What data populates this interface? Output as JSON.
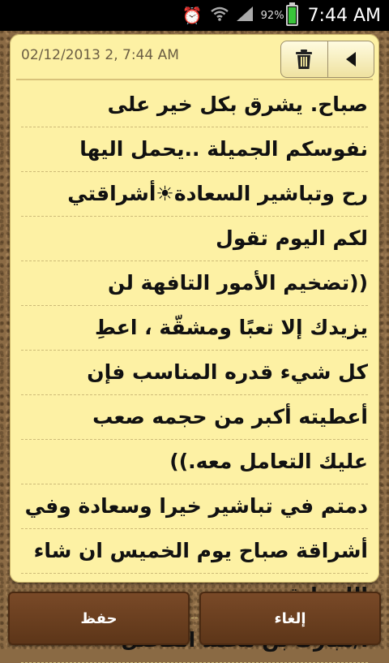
{
  "status_bar": {
    "battery_percent": "92%",
    "time": "7:44 AM",
    "icons": [
      "alarm-icon",
      "wifi-icon",
      "signal-icon",
      "battery-icon"
    ],
    "battery_color": "#39c43a"
  },
  "note": {
    "datetime": "02/12/2013 2, 7:44 AM",
    "delete_icon": "trash-icon",
    "back_icon": "back-arrow-icon",
    "paper_color": "#fdf1a4",
    "lines": [
      "صباح. يشرق بكل خير على",
      "نفوسكم الجميلة ..يحمل اليها",
      "رح وتباشير السعادة☀أشراقتي",
      "لكم اليوم تقول",
      "((تضخيم الأمور التافهة لن",
      "يزيدك إلا تعبًا ومشقّة ، اعطِ",
      "كل شيء قدره المناسب فإن",
      "أعطيته أكبر من حجمه صعب",
      "عليك التعامل معه.))",
      "دمتم في تباشير خيرا وسعادة وفي",
      "أشراقة صباح يوم الخميس ان شاء",
      "الله نلتقي",
      "أ/مبارك بن محمد الفاضل"
    ]
  },
  "buttons": {
    "save_label": "حفظ",
    "cancel_label": "إلغاء",
    "button_color": "#6b3f20"
  }
}
